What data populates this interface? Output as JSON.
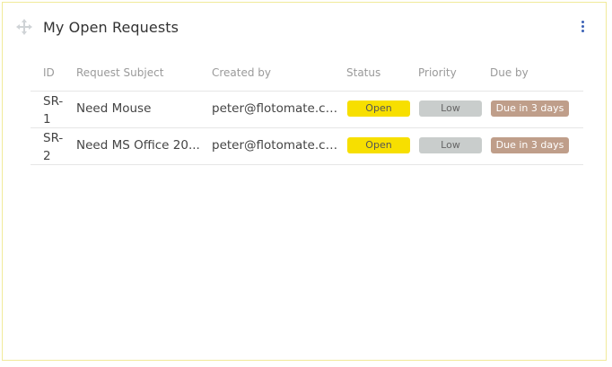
{
  "widget": {
    "title": "My Open Requests",
    "drag_icon": "move-icon",
    "menu_icon": "kebab-menu-icon"
  },
  "table": {
    "columns": [
      "ID",
      "Request Subject",
      "Created by",
      "Status",
      "Priority",
      "Due by"
    ],
    "rows": [
      {
        "id_line1": "SR-",
        "id_line2": "1",
        "subject": "Need Mouse",
        "created_by": "peter@flotomate.co...",
        "status": "Open",
        "priority": "Low",
        "due": "Due in 3 days"
      },
      {
        "id_line1": "SR-",
        "id_line2": "2",
        "subject": "Need MS Office 20...",
        "created_by": "peter@flotomate.co...",
        "status": "Open",
        "priority": "Low",
        "due": "Due in 3 days"
      }
    ]
  },
  "colors": {
    "status_open": "#f7df00",
    "priority_low": "#c9cdcc",
    "due_badge": "#bf9e8a",
    "accent": "#3b62b6"
  }
}
